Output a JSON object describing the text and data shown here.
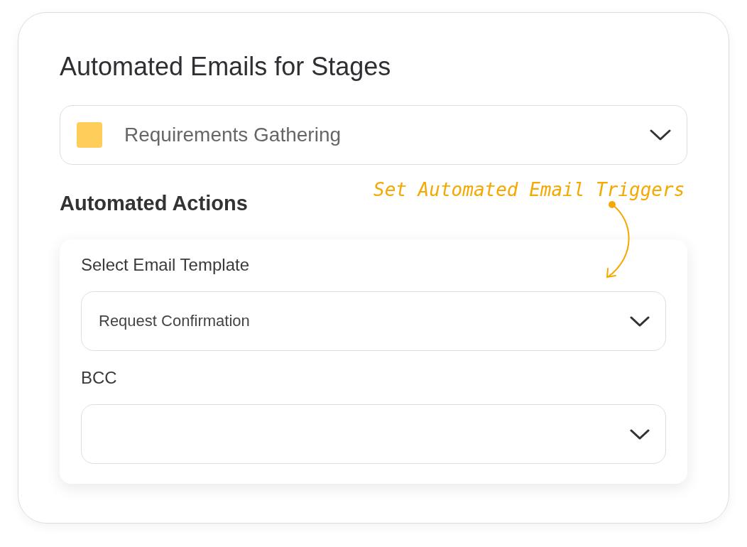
{
  "title": "Automated Emails for Stages",
  "stage_select": {
    "value": "Requirements Gathering",
    "color": "#ffcd5a"
  },
  "section_title": "Automated Actions",
  "annotation": "Set Automated Email Triggers",
  "fields": [
    {
      "label": "Select Email Template",
      "value": "Request Confirmation"
    },
    {
      "label": "BCC"
    }
  ]
}
